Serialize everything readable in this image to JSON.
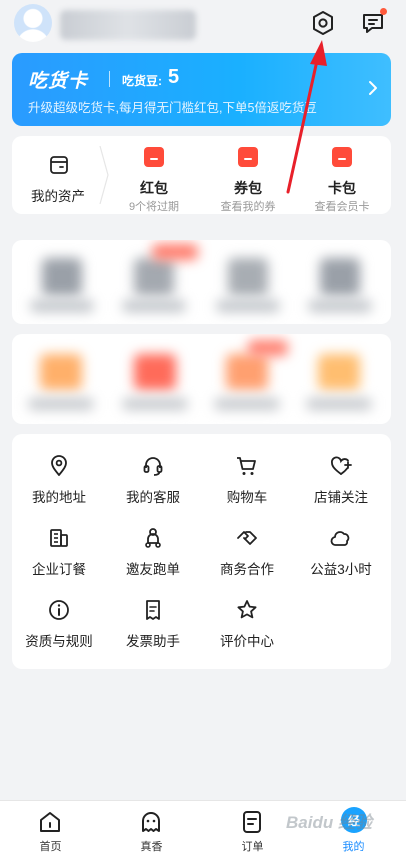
{
  "header": {
    "icons": [
      "avatar",
      "settings-icon",
      "message-icon"
    ],
    "message_has_dot": true
  },
  "foodie_card": {
    "title": "吃货卡",
    "bean_label": "吃货豆:",
    "bean_value": "5",
    "description": "升级超级吃货卡,每月得无门槛红包,下单5倍返吃货豆"
  },
  "assets": {
    "mine_label": "我的资产",
    "items": [
      {
        "title": "红包",
        "subtitle": "9个将过期"
      },
      {
        "title": "券包",
        "subtitle": "查看我的券"
      },
      {
        "title": "卡包",
        "subtitle": "查看会员卡"
      }
    ]
  },
  "services": [
    {
      "label": "我的地址",
      "icon": "location-icon"
    },
    {
      "label": "我的客服",
      "icon": "headset-icon"
    },
    {
      "label": "购物车",
      "icon": "cart-icon"
    },
    {
      "label": "店铺关注",
      "icon": "heart-plus-icon"
    },
    {
      "label": "企业订餐",
      "icon": "building-icon"
    },
    {
      "label": "邀友跑单",
      "icon": "scooter-icon"
    },
    {
      "label": "商务合作",
      "icon": "handshake-icon"
    },
    {
      "label": "公益3小时",
      "icon": "cloud-icon"
    },
    {
      "label": "资质与规则",
      "icon": "info-icon"
    },
    {
      "label": "发票助手",
      "icon": "invoice-icon"
    },
    {
      "label": "评价中心",
      "icon": "star-icon"
    }
  ],
  "tabbar": [
    {
      "label": "首页",
      "icon": "home-icon"
    },
    {
      "label": "真香",
      "icon": "ghost-icon"
    },
    {
      "label": "订单",
      "icon": "order-icon"
    },
    {
      "label": "我的",
      "icon": "mine-icon",
      "active": true
    }
  ],
  "colors": {
    "accent": "#1a8cff",
    "red": "#ff4b3a",
    "card_start": "#2a9bff",
    "card_end": "#3fbeff"
  },
  "watermark": "Baidu 经验"
}
